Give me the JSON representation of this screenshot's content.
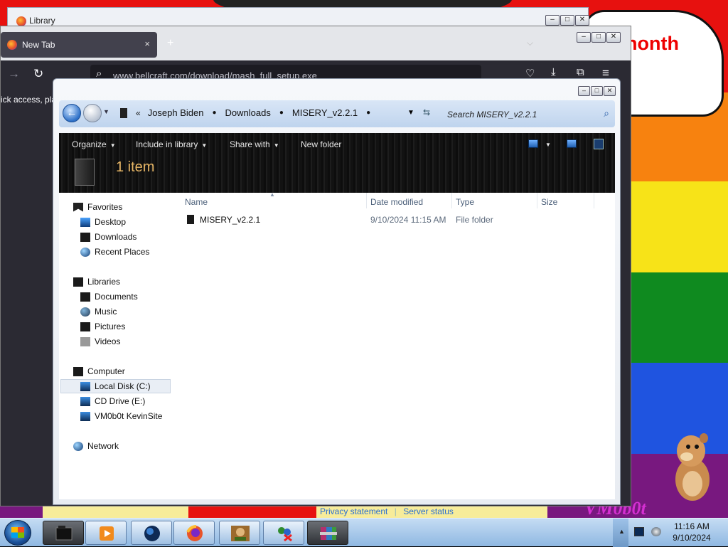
{
  "library_window": {
    "title": "Library"
  },
  "firefox": {
    "tab_title": "New Tab",
    "tab_close": "×",
    "new_tab": "+",
    "list_tabs": "⌵",
    "url": "www.bellcraft.com/download/mash_full_setup.exe",
    "content_text": "ick access, pla"
  },
  "wallpaper": {
    "bubble_text": "nonth",
    "logo_text": "VM0b0t"
  },
  "explorer": {
    "breadcrumb": [
      "Joseph Biden",
      "Downloads",
      "MISERY_v2.2.1"
    ],
    "search_placeholder": "Search MISERY_v2.2.1",
    "toolbar": {
      "organize": "Organize",
      "include_in_library": "Include in library",
      "share_with": "Share with",
      "new_folder": "New folder"
    },
    "item_count": "1 item",
    "nav": {
      "favorites": "Favorites",
      "desktop": "Desktop",
      "downloads": "Downloads",
      "recent_places": "Recent Places",
      "libraries": "Libraries",
      "documents": "Documents",
      "music": "Music",
      "pictures": "Pictures",
      "videos": "Videos",
      "computer": "Computer",
      "local_disk": "Local Disk (C:)",
      "cd_drive": "CD Drive (E:)",
      "vm_share": "VM0b0t KevinSite",
      "network": "Network"
    },
    "columns": {
      "name": "Name",
      "date": "Date modified",
      "type": "Type",
      "size": "Size"
    },
    "files": [
      {
        "name": "MISERY_v2.2.1",
        "date": "9/10/2024 11:15 AM",
        "type": "File folder",
        "size": ""
      }
    ],
    "footer": {
      "privacy": "Privacy statement",
      "server": "Server status"
    }
  },
  "taskbar": {
    "time": "11:16 AM",
    "date": "9/10/2024"
  },
  "colors": {
    "accent": "#2a6fd1",
    "item_count": "#e6b565",
    "wallpaper_logo": "#d42fd1"
  },
  "icons": [
    "firefox-icon",
    "search-icon",
    "back-icon",
    "forward-icon",
    "refresh-icon",
    "pocket-icon",
    "download-icon",
    "extensions-icon",
    "menu-icon",
    "folder-icon",
    "drive-icon",
    "globe-icon",
    "windows-start-icon"
  ]
}
